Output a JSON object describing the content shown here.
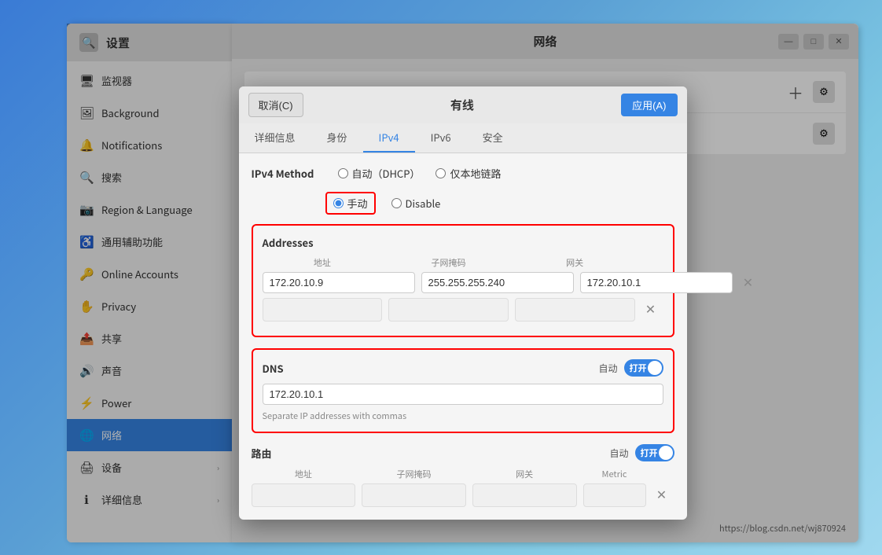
{
  "settings": {
    "title": "设置",
    "search_placeholder": "搜索",
    "nav_items": [
      {
        "id": "background",
        "icon": "🖼",
        "label": "Background",
        "has_arrow": false
      },
      {
        "id": "notifications",
        "icon": "🔔",
        "label": "Notifications",
        "has_arrow": false
      },
      {
        "id": "search",
        "icon": "🔍",
        "label": "搜索",
        "has_arrow": false
      },
      {
        "id": "region",
        "icon": "📷",
        "label": "Region & Language",
        "has_arrow": false
      },
      {
        "id": "accessibility",
        "icon": "♿",
        "label": "通用辅助功能",
        "has_arrow": false
      },
      {
        "id": "online_accounts",
        "icon": "🔑",
        "label": "Online Accounts",
        "has_arrow": false
      },
      {
        "id": "privacy",
        "icon": "✋",
        "label": "Privacy",
        "has_arrow": false
      },
      {
        "id": "sharing",
        "icon": "📤",
        "label": "共享",
        "has_arrow": false
      },
      {
        "id": "sound",
        "icon": "🔊",
        "label": "声音",
        "has_arrow": false
      },
      {
        "id": "power",
        "icon": "⚡",
        "label": "Power",
        "has_arrow": false
      },
      {
        "id": "network",
        "icon": "🌐",
        "label": "网络",
        "has_arrow": false,
        "active": true
      },
      {
        "id": "devices",
        "icon": "🖨",
        "label": "设备",
        "has_arrow": true
      },
      {
        "id": "details",
        "icon": "ℹ",
        "label": "详细信息",
        "has_arrow": true
      }
    ]
  },
  "network_window": {
    "title": "网络",
    "controls": {
      "minimize": "—",
      "maximize": "□",
      "close": "✕"
    }
  },
  "wired_dialog": {
    "cancel_label": "取消(C)",
    "title": "有线",
    "apply_label": "应用(A)",
    "tabs": [
      {
        "id": "details",
        "label": "详细信息"
      },
      {
        "id": "identity",
        "label": "身份"
      },
      {
        "id": "ipv4",
        "label": "IPv4",
        "active": true
      },
      {
        "id": "ipv6",
        "label": "IPv6"
      },
      {
        "id": "security",
        "label": "安全"
      }
    ],
    "ipv4": {
      "method_label": "IPv4 Method",
      "options": [
        {
          "id": "dhcp",
          "label": "自动（DHCP）"
        },
        {
          "id": "manual",
          "label": "手动",
          "selected": true
        },
        {
          "id": "link_local",
          "label": "仅本地链路"
        },
        {
          "id": "disable",
          "label": "Disable"
        }
      ],
      "addresses": {
        "section_label": "Addresses",
        "col_address": "地址",
        "col_subnet": "子网掩码",
        "col_gateway": "网关",
        "rows": [
          {
            "address": "172.20.10.9",
            "subnet": "255.255.255.240",
            "gateway": "172.20.10.1"
          }
        ]
      },
      "dns": {
        "label": "DNS",
        "auto_label": "自动",
        "toggle_label": "打开",
        "value": "172.20.10.1",
        "hint": "Separate IP addresses with commas"
      },
      "routes": {
        "label": "路由",
        "auto_label": "自动",
        "toggle_label": "打开",
        "col_address": "地址",
        "col_subnet": "子网掩码",
        "col_gateway": "网关",
        "col_metric": "Metric"
      }
    }
  },
  "url_text": "https://blog.csdn.net/wj870924"
}
